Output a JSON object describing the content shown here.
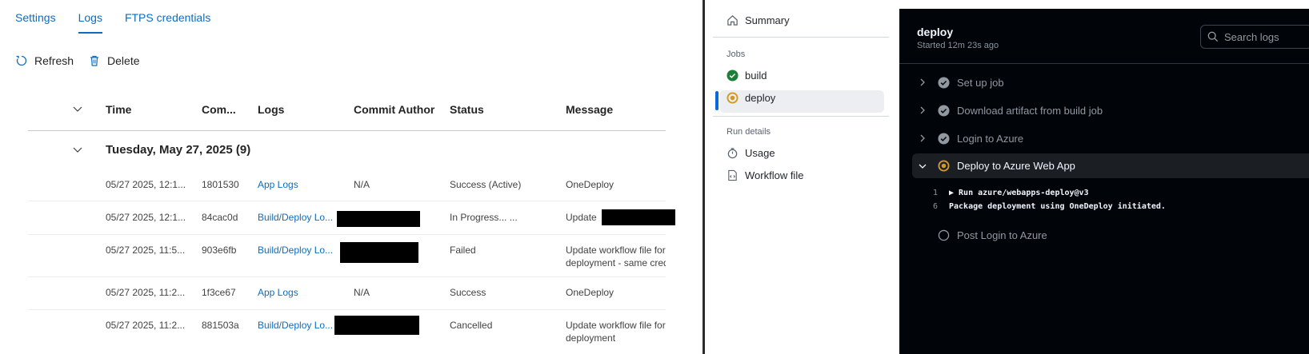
{
  "tabs": [
    {
      "label": "Settings"
    },
    {
      "label": "Logs"
    },
    {
      "label": "FTPS credentials"
    }
  ],
  "toolbar": {
    "refresh_label": "Refresh",
    "delete_label": "Delete"
  },
  "grid": {
    "columns": [
      "Time",
      "Com...",
      "Logs",
      "Commit Author",
      "Status",
      "Message"
    ],
    "group_label": "Tuesday, May 27, 2025 (9)",
    "rows": [
      {
        "time": "05/27 2025, 12:1...",
        "commit": "1801530",
        "logs": "App Logs",
        "author": "N/A",
        "status": "Success (Active)",
        "message": "OneDeploy",
        "message2": ""
      },
      {
        "time": "05/27 2025, 12:1...",
        "commit": "84cac0d",
        "logs": "Build/Deploy Lo...",
        "author": "",
        "status": "In Progress... ...",
        "message": "Update",
        "message2": ""
      },
      {
        "time": "05/27 2025, 11:5...",
        "commit": "903e6fb",
        "logs": "Build/Deploy Lo...",
        "author": "",
        "status": "Failed",
        "message": "Update workflow file for",
        "message2": "deployment - same cred"
      },
      {
        "time": "05/27 2025, 11:2...",
        "commit": "1f3ce67",
        "logs": "App Logs",
        "author": "N/A",
        "status": "Success",
        "message": "OneDeploy",
        "message2": ""
      },
      {
        "time": "05/27 2025, 11:2...",
        "commit": "881503a",
        "logs": "Build/Deploy Lo...",
        "author": "",
        "status": "Cancelled",
        "message": "Update workflow file for",
        "message2": "deployment"
      }
    ]
  },
  "sidebar": {
    "summary_label": "Summary",
    "jobs_heading": "Jobs",
    "jobs": [
      {
        "label": "build",
        "state": "success"
      },
      {
        "label": "deploy",
        "state": "in-progress"
      }
    ],
    "run_details_heading": "Run details",
    "usage_label": "Usage",
    "workflow_file_label": "Workflow file"
  },
  "log": {
    "title": "deploy",
    "subtitle": "Started 12m 23s ago",
    "search_placeholder": "Search logs",
    "steps": [
      {
        "label": "Set up job",
        "state": "done"
      },
      {
        "label": "Download artifact from build job",
        "state": "done"
      },
      {
        "label": "Login to Azure",
        "state": "done"
      },
      {
        "label": "Deploy to Azure Web App",
        "state": "in-progress"
      },
      {
        "label": "Post Login to Azure",
        "state": "pending"
      }
    ],
    "lines": [
      {
        "num": "1",
        "text": "▶ Run azure/webapps-deploy@v3"
      },
      {
        "num": "6",
        "text": "Package deployment using OneDeploy initiated."
      }
    ]
  },
  "colors": {
    "azure_link": "#0f6cbd",
    "github_blue": "#0969da",
    "success_green": "#1a7f37",
    "in_progress_yellow": "#d29922",
    "log_background": "#010409"
  }
}
